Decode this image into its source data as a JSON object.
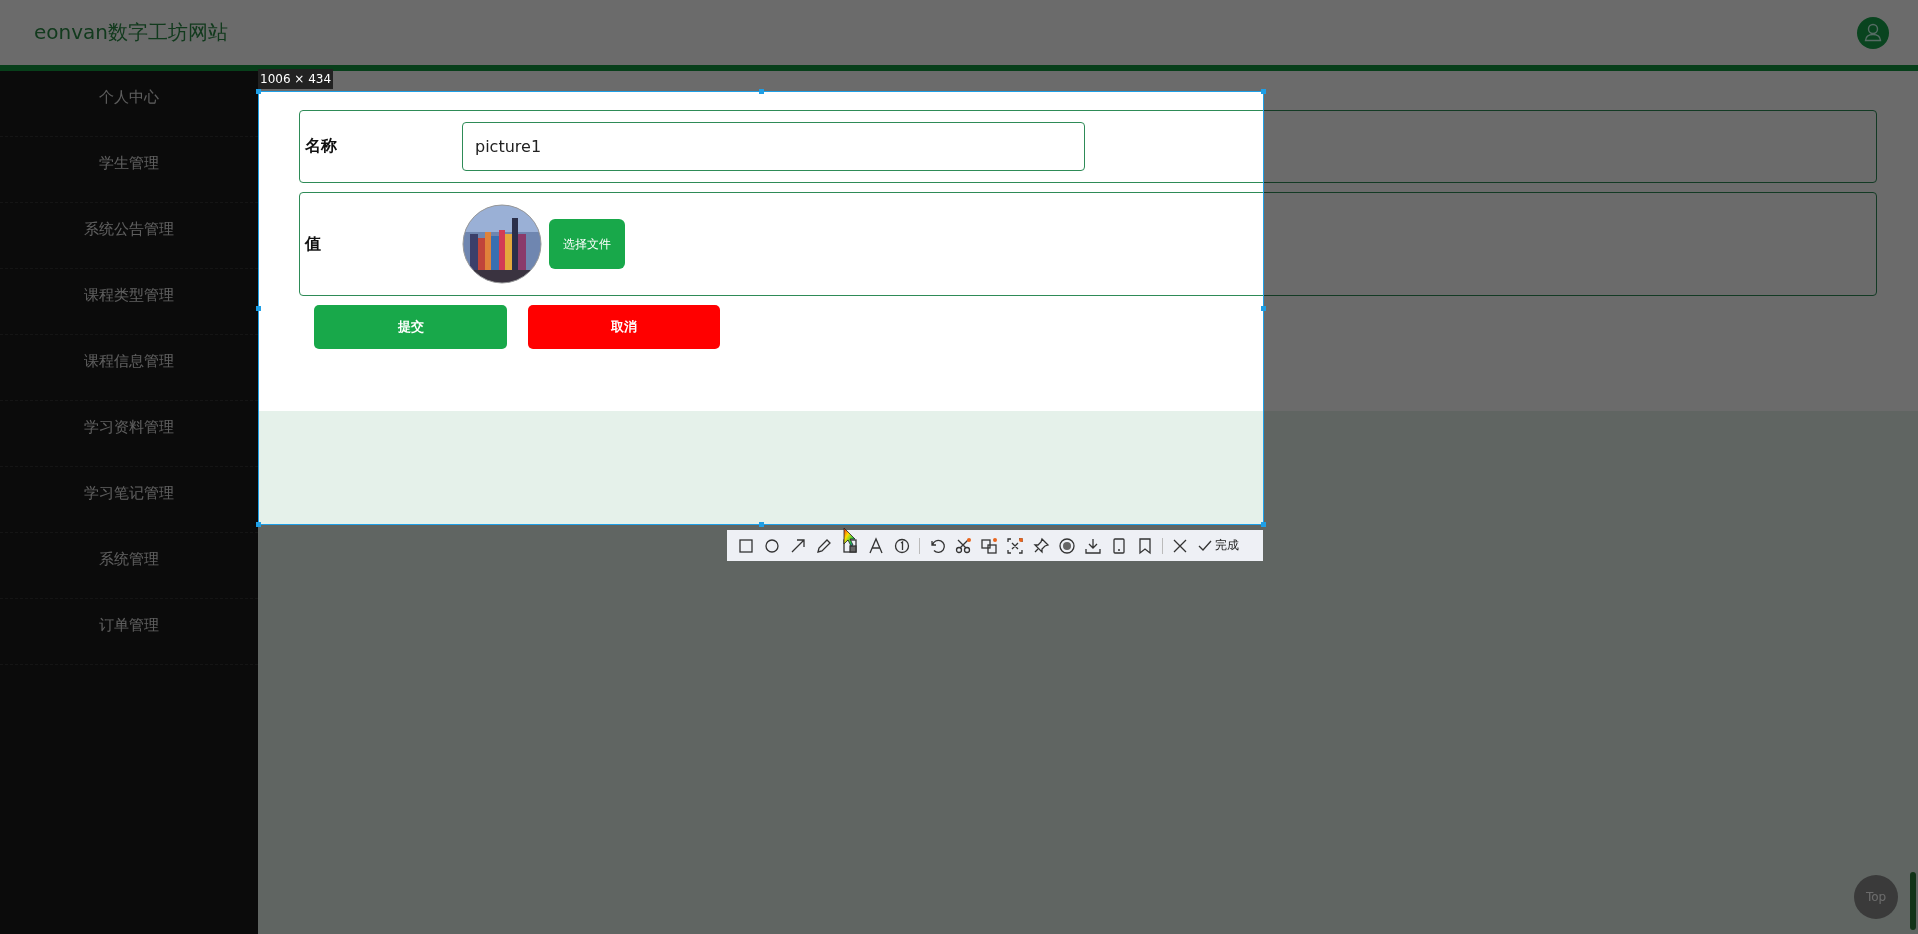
{
  "header": {
    "title": "eonvan数字工坊网站"
  },
  "sidebar": {
    "items": [
      {
        "label": "个人中心"
      },
      {
        "label": "学生管理"
      },
      {
        "label": "系统公告管理"
      },
      {
        "label": "课程类型管理"
      },
      {
        "label": "课程信息管理"
      },
      {
        "label": "学习资料管理"
      },
      {
        "label": "学习笔记管理"
      },
      {
        "label": "系统管理"
      },
      {
        "label": "订单管理"
      }
    ]
  },
  "form": {
    "fields": [
      {
        "kind": "text",
        "label": "名称",
        "value": "picture1"
      },
      {
        "label": "值",
        "button": "选择文件"
      }
    ],
    "buttons": [
      {
        "kind": "submit",
        "label": "提交"
      },
      {
        "kind": "cancel",
        "label": "取消"
      }
    ]
  },
  "back_to_top": "Top",
  "screenshot_tool": {
    "size_label": "1006 × 434",
    "done_label": "完成"
  }
}
